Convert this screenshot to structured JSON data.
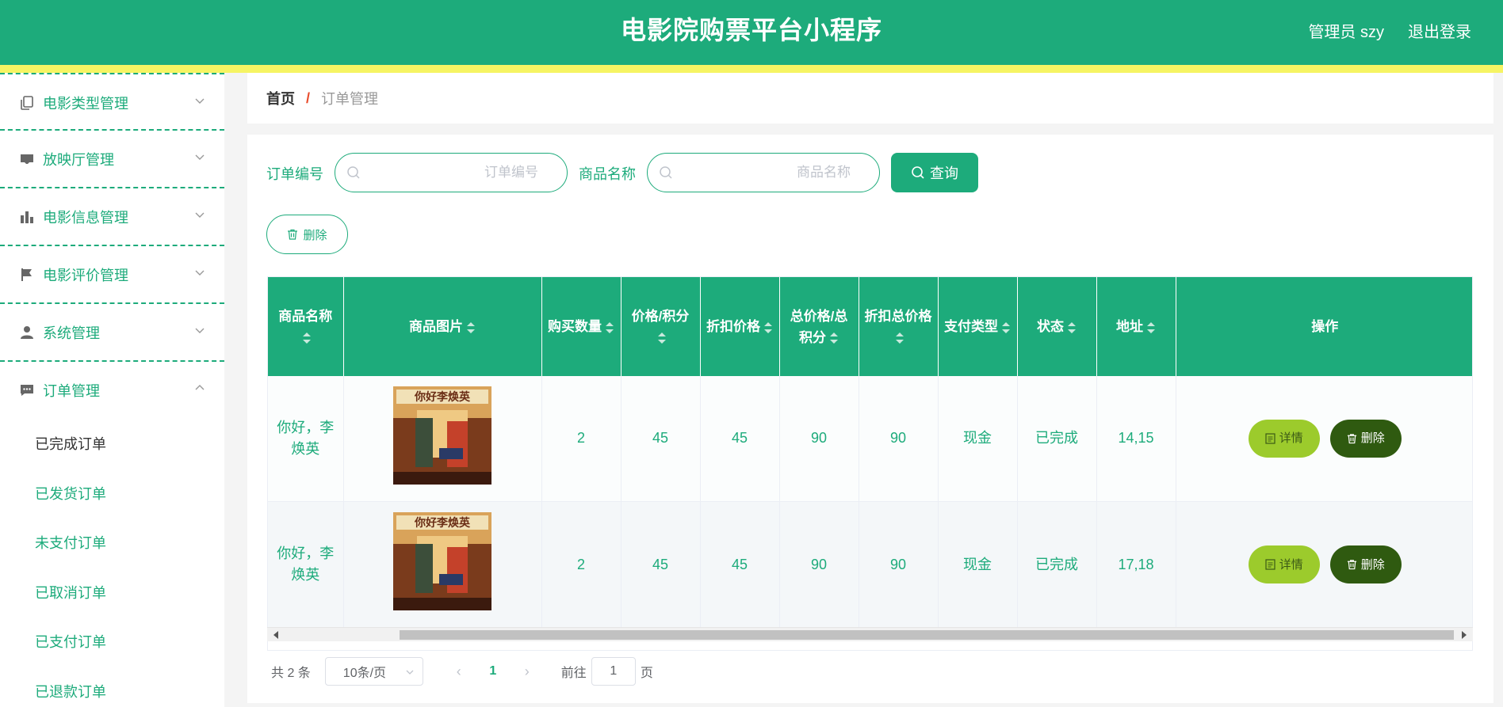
{
  "header": {
    "title": "电影院购票平台小程序",
    "user": "管理员 szy",
    "logout": "退出登录",
    "color": "#1dab7b",
    "stripe_color": "#f6f463"
  },
  "sidebar": {
    "groups": [
      {
        "label": "电影类型管理",
        "icon": "copy-icon",
        "expanded": false
      },
      {
        "label": "放映厅管理",
        "icon": "inbox-icon",
        "expanded": false
      },
      {
        "label": "电影信息管理",
        "icon": "bar-chart-icon",
        "expanded": false
      },
      {
        "label": "电影评价管理",
        "icon": "flag-icon",
        "expanded": false
      },
      {
        "label": "系统管理",
        "icon": "user-icon",
        "expanded": false
      },
      {
        "label": "订单管理",
        "icon": "message-icon",
        "expanded": true
      }
    ],
    "submenu": [
      {
        "label": "已完成订单",
        "active": true
      },
      {
        "label": "已发货订单",
        "active": false
      },
      {
        "label": "未支付订单",
        "active": false
      },
      {
        "label": "已取消订单",
        "active": false
      },
      {
        "label": "已支付订单",
        "active": false
      },
      {
        "label": "已退款订单",
        "active": false
      }
    ]
  },
  "breadcrumb": {
    "home": "首页",
    "separator": "/",
    "current": "订单管理"
  },
  "search": {
    "order_no_label": "订单编号",
    "order_no_placeholder": "订单编号",
    "order_no_value": "",
    "product_label": "商品名称",
    "product_placeholder": "商品名称",
    "product_value": "",
    "query_button": "查询"
  },
  "toolbar": {
    "delete_button": "删除"
  },
  "table": {
    "columns": [
      {
        "label": "商品名称",
        "sortable": true
      },
      {
        "label": "商品图片",
        "sortable": true
      },
      {
        "label": "购买数量",
        "sortable": true
      },
      {
        "label": "价格/积分",
        "sortable": true
      },
      {
        "label": "折扣价格",
        "sortable": true
      },
      {
        "label": "总价格/总积分",
        "sortable": true
      },
      {
        "label": "折扣总价格",
        "sortable": true
      },
      {
        "label": "支付类型",
        "sortable": true
      },
      {
        "label": "状态",
        "sortable": true
      },
      {
        "label": "地址",
        "sortable": true
      },
      {
        "label": "操作",
        "sortable": false
      }
    ],
    "rows": [
      {
        "name": "你好，李焕英",
        "qty": "2",
        "price": "45",
        "discount_price": "45",
        "total": "90",
        "discount_total": "90",
        "pay_type": "现金",
        "status": "已完成",
        "address": "14,15"
      },
      {
        "name": "你好，李焕英",
        "qty": "2",
        "price": "45",
        "discount_price": "45",
        "total": "90",
        "discount_total": "90",
        "pay_type": "现金",
        "status": "已完成",
        "address": "17,18"
      }
    ],
    "detail_button": "详情",
    "delete_button": "删除"
  },
  "pagination": {
    "total": "共 2 条",
    "page_size": "10条/页",
    "current_page": "1",
    "goto_label": "前往",
    "goto_value": "1",
    "page_unit": "页"
  }
}
